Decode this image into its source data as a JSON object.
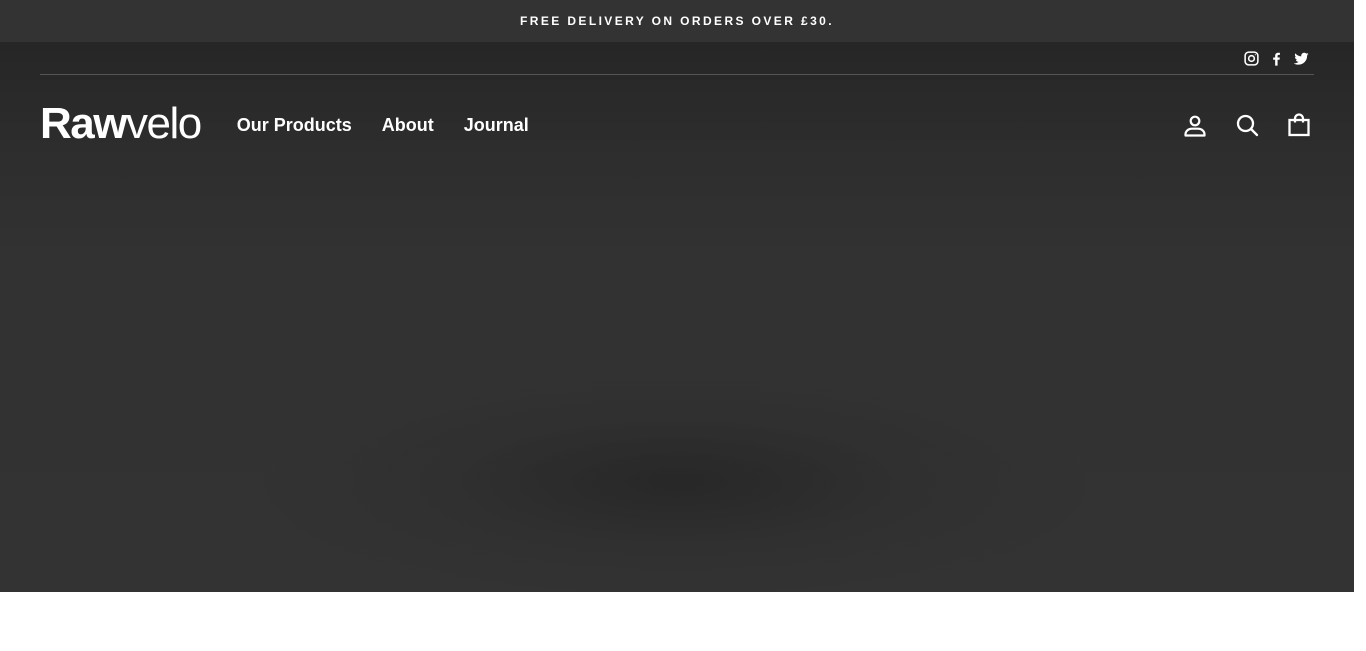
{
  "announcement": {
    "text": "FREE DELIVERY ON ORDERS OVER £30."
  },
  "social": {
    "items": [
      {
        "icon": "instagram-icon"
      },
      {
        "icon": "facebook-icon"
      },
      {
        "icon": "twitter-icon"
      }
    ]
  },
  "header": {
    "logo_bold": "Raw",
    "logo_light": "velo",
    "nav": [
      {
        "label": "Our Products"
      },
      {
        "label": "About"
      },
      {
        "label": "Journal"
      }
    ],
    "actions": [
      {
        "icon": "account-icon"
      },
      {
        "icon": "search-icon"
      },
      {
        "icon": "cart-icon"
      }
    ]
  },
  "colors": {
    "announcement_bg": "#333333",
    "hero_bg": "#333333",
    "text": "#ffffff"
  }
}
